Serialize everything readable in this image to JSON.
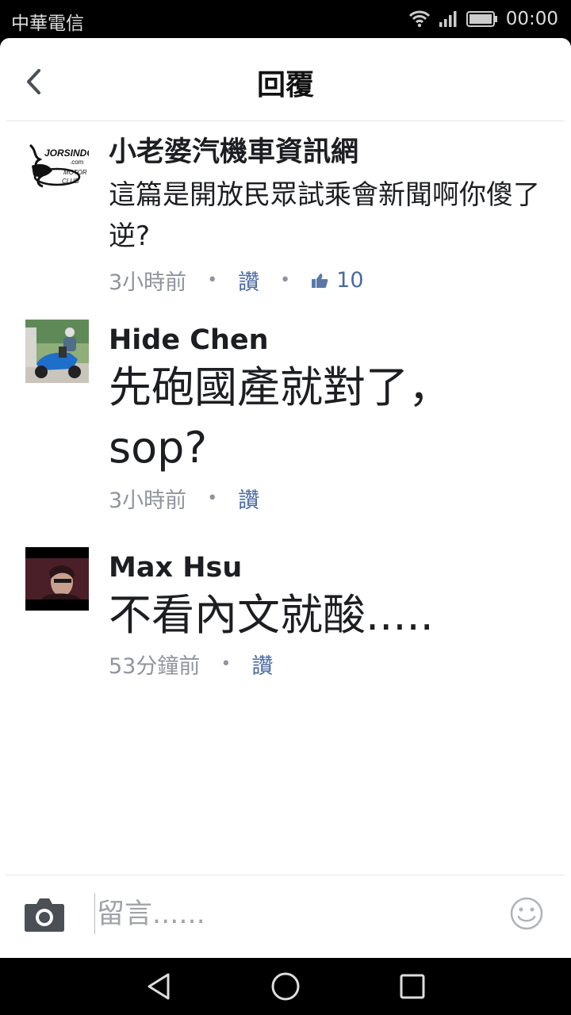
{
  "status_bar": {
    "carrier": "中華電信",
    "time": "00:00"
  },
  "header": {
    "title": "回覆"
  },
  "comments": [
    {
      "author": "小老婆汽機車資訊網",
      "text": "這篇是開放民眾試乘會新聞啊你傻了逆?",
      "time": "3小時前",
      "like_label": "讚",
      "like_count": "10",
      "avatar_icon": "jorsindo-motor-club-logo",
      "avatar_logo_text": "JORSINDO .com MOTOR CLUB"
    },
    {
      "author": "Hide Chen",
      "text": "先砲國產就對了，sop?",
      "time": "3小時前",
      "like_label": "讚",
      "avatar_icon": "scooter-rider-photo"
    },
    {
      "author": "Max Hsu",
      "text": "不看內文就酸.....",
      "time": "53分鐘前",
      "like_label": "讚",
      "avatar_icon": "dark-portrait-photo"
    }
  ],
  "composer": {
    "placeholder": "留言......"
  },
  "icons": {
    "back": "chevron-left-icon",
    "camera": "camera-icon",
    "emoji": "smiley-icon",
    "like": "thumbs-up-icon",
    "nav": [
      "back-triangle-icon",
      "home-circle-icon",
      "recents-square-icon"
    ]
  },
  "colors": {
    "link": "#4b6aa0",
    "meta": "#90949c",
    "text": "#1c1e21"
  }
}
